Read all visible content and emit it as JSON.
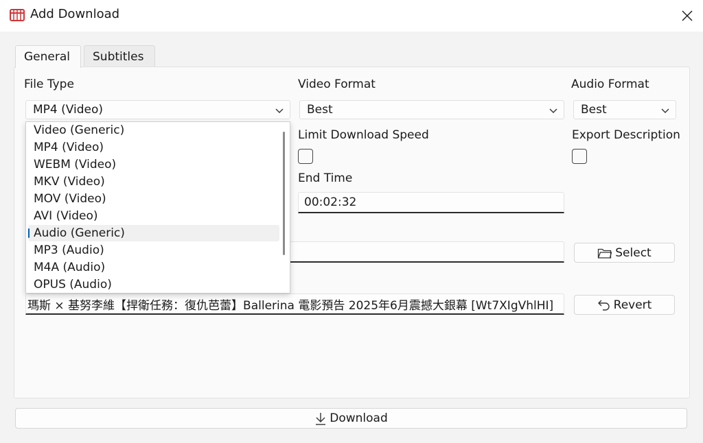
{
  "window": {
    "title": "Add Download",
    "close_glyph": "✕"
  },
  "tabs": [
    {
      "label": "General",
      "active": true
    },
    {
      "label": "Subtitles",
      "active": false
    }
  ],
  "file_type": {
    "label": "File Type",
    "value": "MP4 (Video)",
    "options": [
      "Video (Generic)",
      "MP4 (Video)",
      "WEBM (Video)",
      "MKV (Video)",
      "MOV (Video)",
      "AVI (Video)",
      "Audio (Generic)",
      "MP3 (Audio)",
      "M4A (Audio)",
      "OPUS (Audio)"
    ],
    "highlighted": "Audio (Generic)"
  },
  "video_format": {
    "label": "Video Format",
    "value": "Best"
  },
  "audio_format": {
    "label": "Audio Format",
    "value": "Best"
  },
  "limit_speed": {
    "label": "Limit Download Speed",
    "checked": false
  },
  "export_description": {
    "label": "Export Description",
    "checked": false
  },
  "end_time": {
    "label": "End Time",
    "value": "00:02:32"
  },
  "save_folder": {
    "value": "",
    "select_label": "Select"
  },
  "file_name": {
    "value": "瑪斯 × 基努李維【捍衛任務：復仇芭蕾】Ballerina 電影預告 2025年6月震撼大銀幕 [Wt7XIgVhlHI]",
    "revert_label": "Revert"
  },
  "download_label": "Download",
  "colors": {
    "accent": "#005fb8",
    "icon_red": "#d13438",
    "panel": "#fafafa",
    "background": "#f3f3f3"
  },
  "icons": [
    "app-icon",
    "close-icon",
    "chevron-down-icon",
    "folder-icon",
    "undo-icon",
    "download-arrow-icon"
  ]
}
